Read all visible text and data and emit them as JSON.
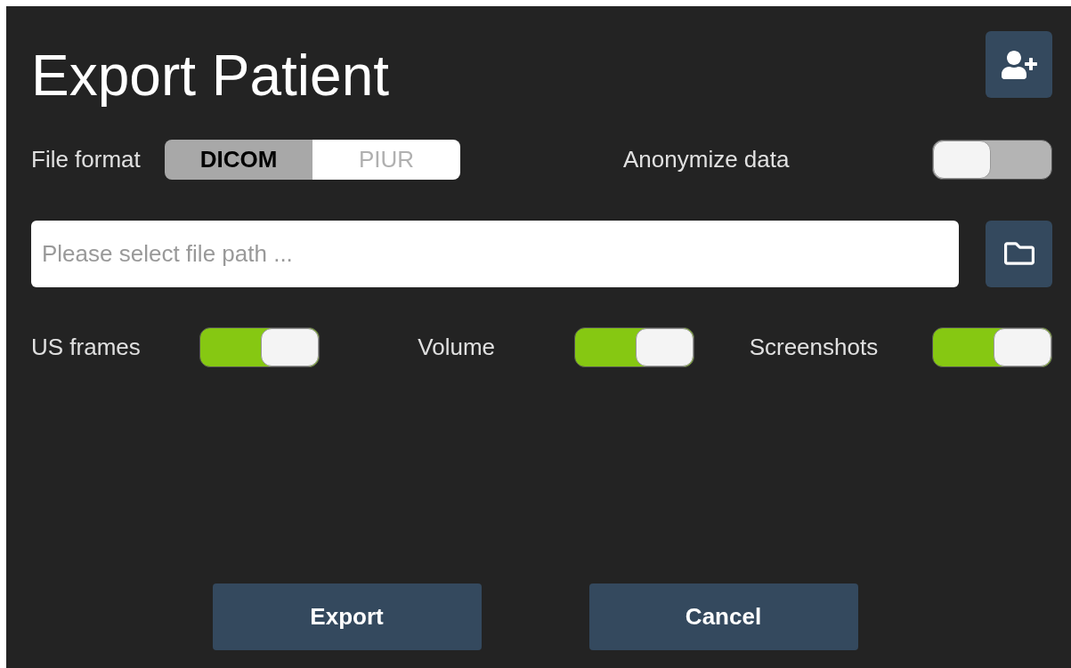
{
  "window": {
    "title": "Export Patient"
  },
  "file_format": {
    "label": "File format",
    "options": [
      {
        "label": "DICOM",
        "selected": true
      },
      {
        "label": "PIUR",
        "selected": false
      }
    ]
  },
  "anonymize": {
    "label": "Anonymize data",
    "on": false
  },
  "file_path": {
    "placeholder": "Please select file path ..."
  },
  "toggles": [
    {
      "label": "US frames",
      "on": true
    },
    {
      "label": "Volume",
      "on": true
    },
    {
      "label": "Screenshots",
      "on": true
    }
  ],
  "buttons": [
    {
      "label": "Export"
    },
    {
      "label": "Cancel"
    }
  ]
}
